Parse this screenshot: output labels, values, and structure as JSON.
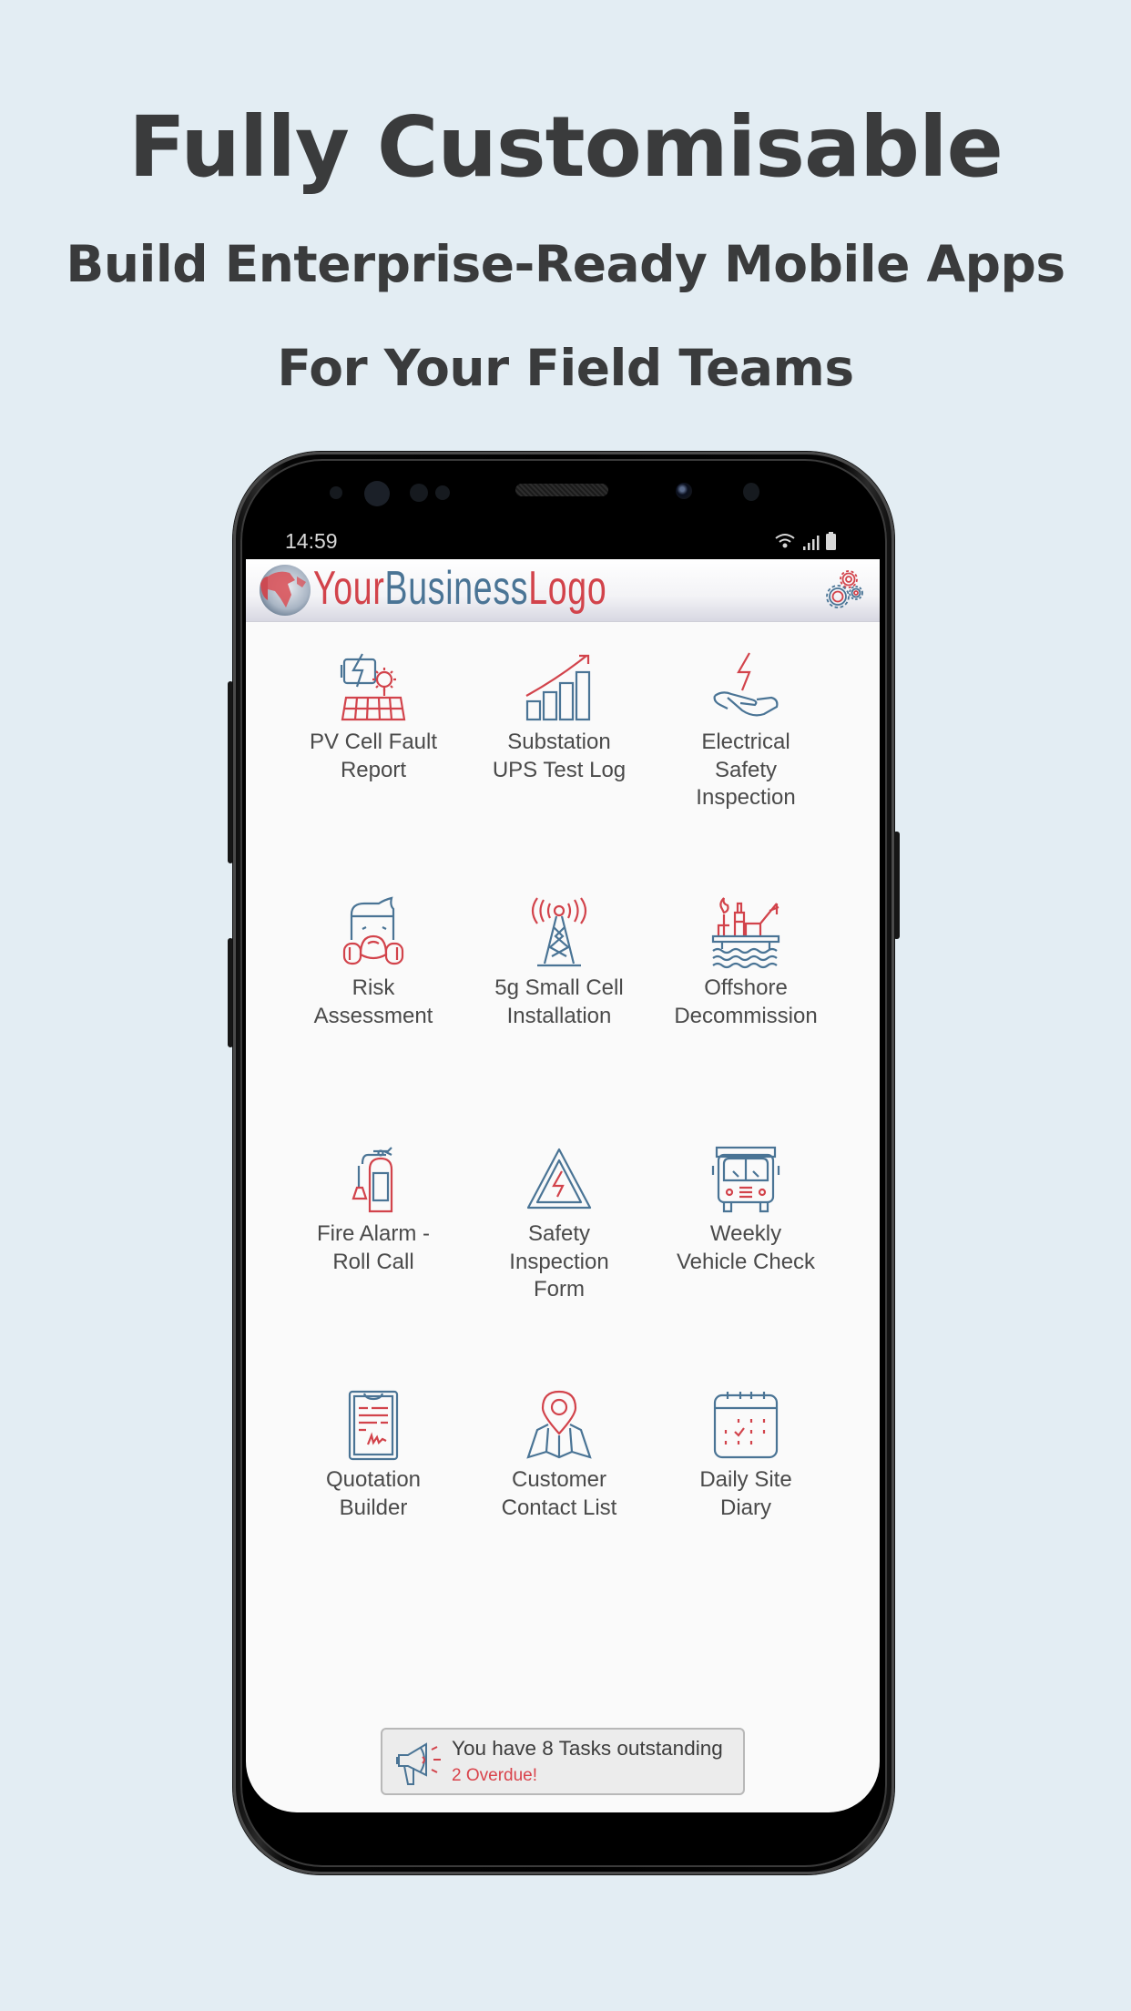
{
  "marketing": {
    "title": "Fully Customisable",
    "subtitle_line1": "Build Enterprise-Ready Mobile Apps",
    "subtitle_line2": "For Your Field Teams"
  },
  "status_bar": {
    "time": "14:59",
    "icons": [
      "wifi-icon",
      "signal-icon",
      "battery-icon"
    ]
  },
  "app_header": {
    "logo_part1": "Your",
    "logo_part2": "Business",
    "logo_part3": "Logo",
    "settings_icon": "gears-icon"
  },
  "colors": {
    "brand_red": "#d2434b",
    "brand_blue": "#4a7495",
    "background": "#e3edf3",
    "text": "#3a3b3c"
  },
  "tiles": [
    {
      "label": "PV Cell Fault\nReport",
      "icon": "solar-panel-icon"
    },
    {
      "label": "Substation\nUPS Test Log",
      "icon": "bar-chart-growth-icon"
    },
    {
      "label": "Electrical\nSafety\nInspection",
      "icon": "hand-lightning-icon"
    },
    {
      "label": "Risk\nAssessment",
      "icon": "gas-mask-icon"
    },
    {
      "label": "5g Small Cell\nInstallation",
      "icon": "cell-tower-icon"
    },
    {
      "label": "Offshore\nDecommission",
      "icon": "oil-rig-icon"
    },
    {
      "label": "Fire Alarm -\nRoll Call",
      "icon": "fire-extinguisher-icon"
    },
    {
      "label": "Safety\nInspection\nForm",
      "icon": "warning-triangle-icon"
    },
    {
      "label": "Weekly\nVehicle Check",
      "icon": "truck-icon"
    },
    {
      "label": "Quotation\nBuilder",
      "icon": "clipboard-icon"
    },
    {
      "label": "Customer\nContact List",
      "icon": "map-pin-icon"
    },
    {
      "label": "Daily Site\nDiary",
      "icon": "calendar-icon"
    }
  ],
  "task_banner": {
    "message": "You have 8 Tasks outstanding",
    "overdue": "2 Overdue!",
    "icon": "megaphone-icon"
  }
}
